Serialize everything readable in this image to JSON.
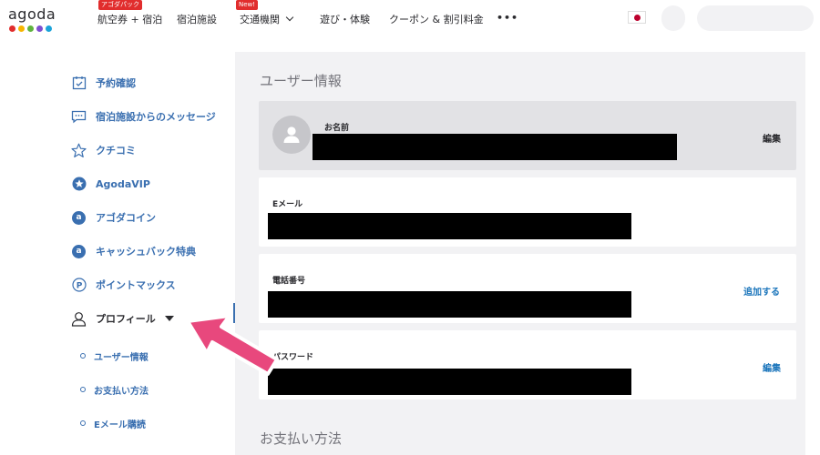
{
  "header": {
    "logo_text": "agoda",
    "logo_dot_colors": [
      "#e12d2d",
      "#f7b500",
      "#5fb33e",
      "#7e4fcf",
      "#1ba3d9"
    ],
    "nav": [
      {
        "label": "航空券 + 宿泊",
        "badge": "アゴダパック"
      },
      {
        "label": "宿泊施設",
        "badge": ""
      },
      {
        "label": "交通機関",
        "badge": "New!"
      },
      {
        "label": "遊び・体験",
        "badge": ""
      },
      {
        "label": "クーポン & 割引料金",
        "badge": ""
      },
      {
        "label": "•••",
        "badge": ""
      }
    ],
    "flag_icon": "japan-flag-icon"
  },
  "sidebar": {
    "items": [
      {
        "label": "予約確認",
        "icon": "calendar-check-icon"
      },
      {
        "label": "宿泊施設からのメッセージ",
        "icon": "message-icon"
      },
      {
        "label": "クチコミ",
        "icon": "star-outline-icon"
      },
      {
        "label": "AgodaVIP",
        "icon": "star-badge-icon"
      },
      {
        "label": "アゴダコイン",
        "icon": "coin-icon"
      },
      {
        "label": "キャッシュバック特典",
        "icon": "cashback-icon"
      },
      {
        "label": "ポイントマックス",
        "icon": "pointsmax-icon"
      },
      {
        "label": "プロフィール",
        "icon": "user-icon"
      }
    ],
    "subitems": [
      {
        "label": "ユーザー情報"
      },
      {
        "label": "お支払い方法"
      },
      {
        "label": "Eメール購読"
      }
    ]
  },
  "main": {
    "section_title": "ユーザー情報",
    "name": {
      "label": "お名前",
      "action": "編集"
    },
    "email": {
      "label": "Eメール"
    },
    "phone": {
      "label": "電話番号",
      "action": "追加する"
    },
    "password": {
      "label": "パスワード",
      "action": "編集"
    },
    "next_section_title": "お支払い方法"
  },
  "colors": {
    "link": "#3a6fb0",
    "action": "#1b75bb",
    "annotation_arrow": "#e8487d"
  }
}
